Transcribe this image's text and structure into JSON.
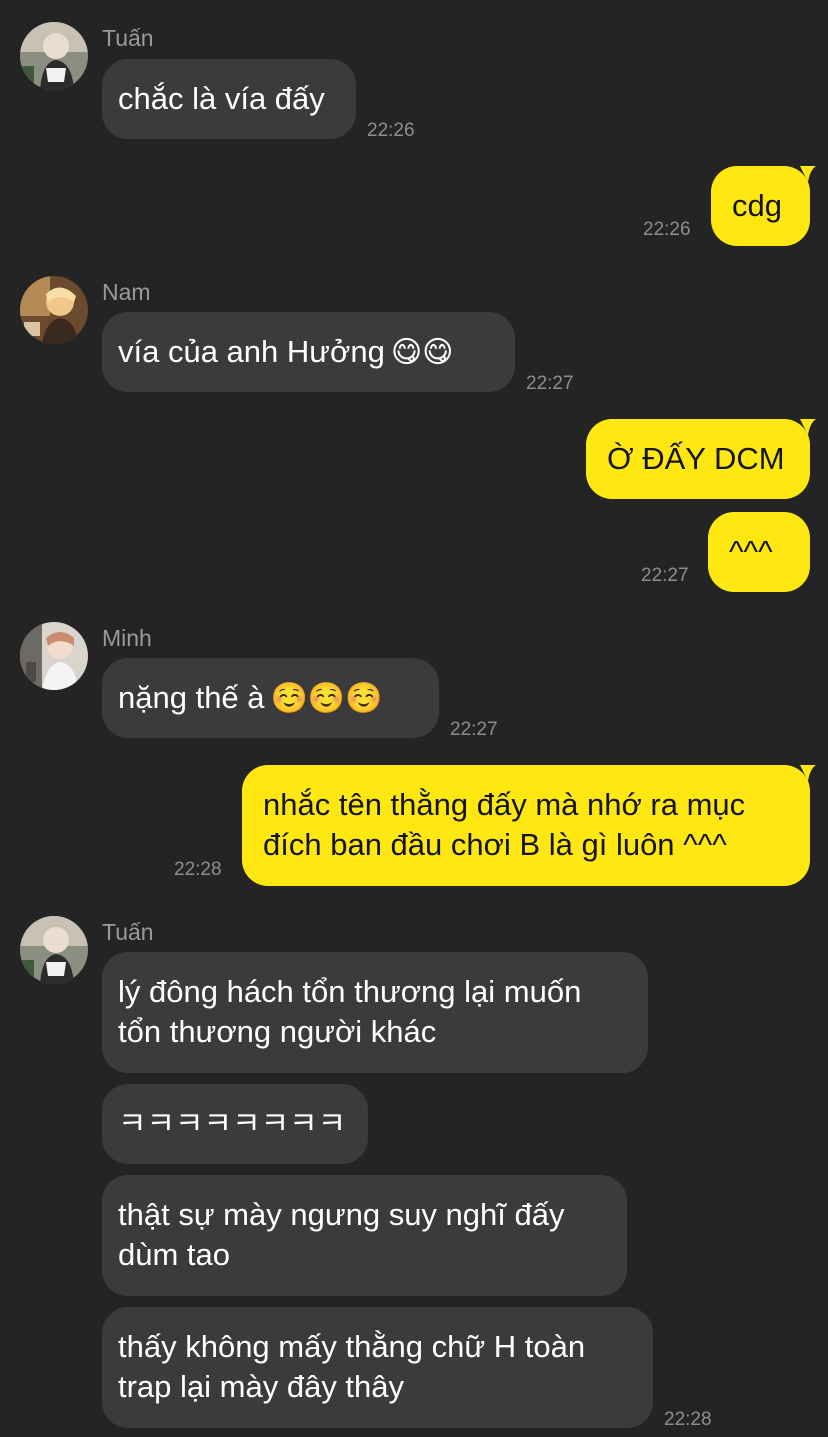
{
  "colors": {
    "background": "#242424",
    "incoming_bubble": "#3b3b3d",
    "outgoing_bubble": "#ffe812",
    "incoming_text": "#ffffff",
    "outgoing_text": "#141414",
    "meta_text": "#9a9a9a"
  },
  "messages": [
    {
      "id": "m1",
      "sender": "Tuấn",
      "text": "chắc là vía đấy",
      "time": "22:26"
    },
    {
      "id": "m2",
      "text": "cdg",
      "time": "22:26"
    },
    {
      "id": "m3",
      "sender": "Nam",
      "text": "vía của anh Hưởng",
      "emoji": "😋😋",
      "time": "22:27"
    },
    {
      "id": "m4",
      "text": "Ờ ĐẤY DCM"
    },
    {
      "id": "m5",
      "text": "^^^",
      "time": "22:27"
    },
    {
      "id": "m6",
      "sender": "Minh",
      "text": "nặng thế à",
      "emoji": "☺️☺️☺️",
      "time": "22:27"
    },
    {
      "id": "m7",
      "text": "nhắc tên thằng đấy mà nhớ ra mục",
      "text2": "đích ban đầu chơi B là gì luôn ^^^",
      "time": "22:28"
    },
    {
      "id": "m8",
      "sender": "Tuấn",
      "text": "lý đông hách tổn thương lại muốn",
      "text2": "tổn thương người khác"
    },
    {
      "id": "m9",
      "text": "ㅋㅋㅋㅋㅋㅋㅋㅋ"
    },
    {
      "id": "m10",
      "text": "thật sự mày ngưng suy nghĩ đấy",
      "text2": "dùm tao"
    },
    {
      "id": "m11",
      "text": "thấy không mấy thằng chữ H toàn",
      "text2": "trap lại mày đây thây",
      "time": "22:28"
    }
  ]
}
